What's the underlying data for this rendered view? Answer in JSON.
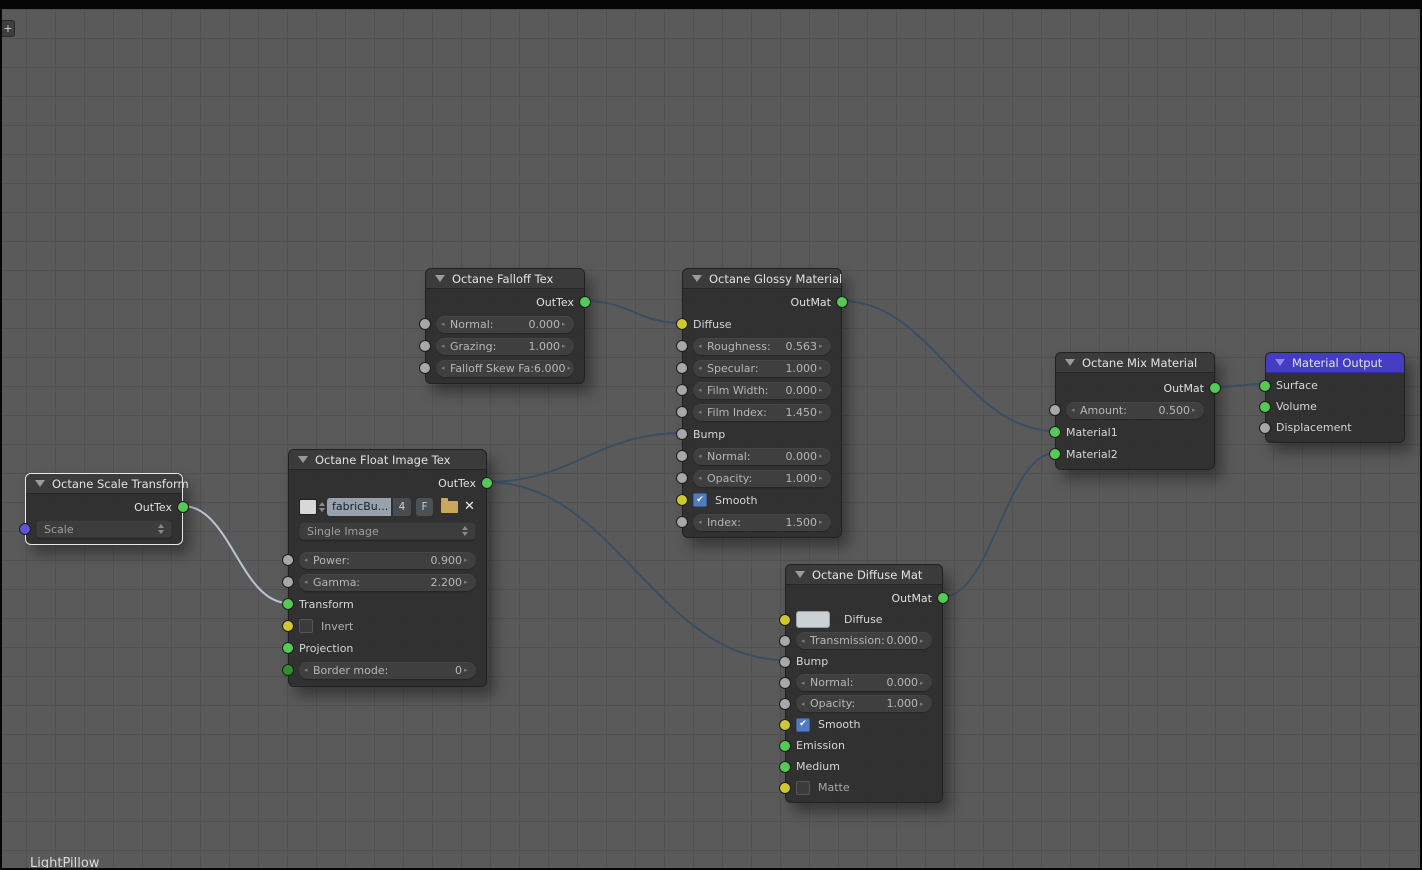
{
  "editor": {
    "expand_button": "+",
    "tree_name": "LightPillow"
  },
  "colors": {
    "background": "#5a5a5a",
    "grid_line": "#515151",
    "node_body": "#2f2f2f",
    "node_header": "#3b3b3b",
    "output_node_header": "#443dc1",
    "link": "#3a4e63",
    "link_selected": "#b9c7d4",
    "socket_green": "#55c955",
    "socket_dark_green": "#2f8f2f",
    "socket_yellow": "#cdc832",
    "socket_gray": "#a8a8a8",
    "socket_purple": "#5c56d6",
    "checkbox_checked": "#4f7cc0"
  },
  "nodes": {
    "falloff": {
      "title": "Octane Falloff Tex",
      "output": "OutTex",
      "normal": {
        "label": "Normal:",
        "value": "0.000"
      },
      "grazing": {
        "label": "Grazing:",
        "value": "1.000"
      },
      "falloff_skew": {
        "label": "Falloff Skew Fa:",
        "value": "6.000"
      }
    },
    "glossy": {
      "title": "Octane Glossy Material",
      "output": "OutMat",
      "diffuse": "Diffuse",
      "roughness": {
        "label": "Roughness:",
        "value": "0.563"
      },
      "specular": {
        "label": "Specular:",
        "value": "1.000"
      },
      "film_width": {
        "label": "Film Width:",
        "value": "0.000"
      },
      "film_index": {
        "label": "Film Index:",
        "value": "1.450"
      },
      "bump": "Bump",
      "normal": {
        "label": "Normal:",
        "value": "0.000"
      },
      "opacity": {
        "label": "Opacity:",
        "value": "1.000"
      },
      "smooth": "Smooth",
      "index": {
        "label": "Index:",
        "value": "1.500"
      }
    },
    "mix": {
      "title": "Octane Mix Material",
      "output": "OutMat",
      "amount": {
        "label": "Amount:",
        "value": "0.500"
      },
      "material1": "Material1",
      "material2": "Material2"
    },
    "material_output": {
      "title": "Material Output",
      "surface": "Surface",
      "volume": "Volume",
      "displacement": "Displacement"
    },
    "scale_transform": {
      "title": "Octane Scale Transform",
      "output": "OutTex",
      "scale": "Scale"
    },
    "float_image": {
      "title": "Octane Float Image Tex",
      "output": "OutTex",
      "image_name": "fabricBu...",
      "users_count": "4",
      "fake_user": "F",
      "mode": "Single Image",
      "power": {
        "label": "Power:",
        "value": "0.900"
      },
      "gamma": {
        "label": "Gamma:",
        "value": "2.200"
      },
      "transform": "Transform",
      "invert": "Invert",
      "projection": "Projection",
      "border_mode": {
        "label": "Border mode:",
        "value": "0"
      }
    },
    "diffuse_mat": {
      "title": "Octane Diffuse Mat",
      "output": "OutMat",
      "diffuse": "Diffuse",
      "transmission": {
        "label": "Transmission:",
        "value": "0.000"
      },
      "bump": "Bump",
      "normal": {
        "label": "Normal:",
        "value": "0.000"
      },
      "opacity": {
        "label": "Opacity:",
        "value": "1.000"
      },
      "smooth": "Smooth",
      "emission": "Emission",
      "medium": "Medium",
      "matte": "Matte"
    }
  },
  "links": [
    {
      "from": "Octane Falloff Tex.OutTex",
      "to": "Octane Glossy Material.Diffuse"
    },
    {
      "from": "Octane Float Image Tex.OutTex",
      "to": "Octane Glossy Material.Bump"
    },
    {
      "from": "Octane Float Image Tex.OutTex",
      "to": "Octane Diffuse Mat.Bump"
    },
    {
      "from": "Octane Scale Transform.OutTex",
      "to": "Octane Float Image Tex.Transform"
    },
    {
      "from": "Octane Glossy Material.OutMat",
      "to": "Octane Mix Material.Material1"
    },
    {
      "from": "Octane Diffuse Mat.OutMat",
      "to": "Octane Mix Material.Material2"
    },
    {
      "from": "Octane Mix Material.OutMat",
      "to": "Material Output.Surface"
    }
  ]
}
